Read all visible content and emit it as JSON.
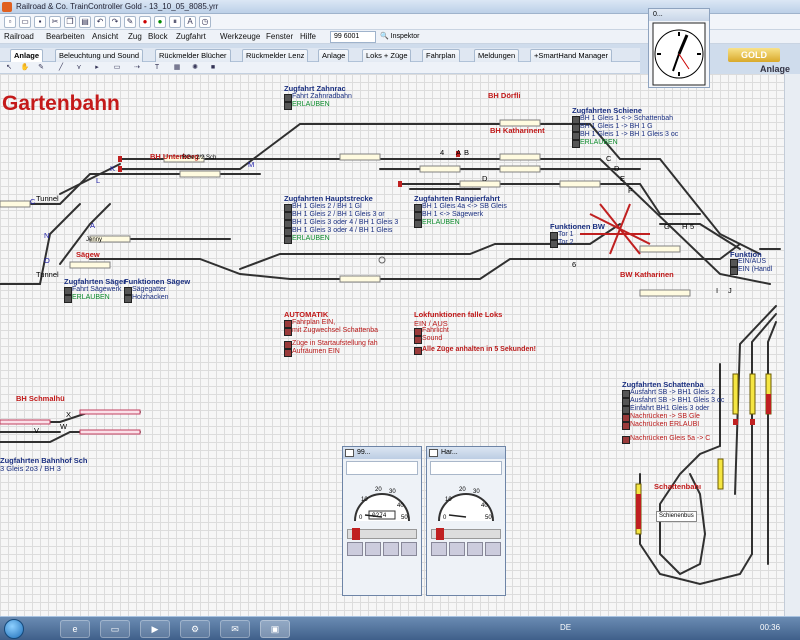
{
  "window": {
    "title": "Railroad & Co. TrainController Gold - 13_10_05_8085.yrr"
  },
  "menu": {
    "items": [
      "Railroad",
      "Bearbeiten",
      "Ansicht",
      "Zug",
      "Block",
      "Zugfahrt",
      "Werkzeuge",
      "Fenster",
      "Hilfe"
    ],
    "loco_select": "99 6001",
    "inspector": "Inspektor"
  },
  "tabs": [
    "Anlage",
    "Beleuchtung und Sound",
    "Rückmelder Blücher",
    "Rückmelder Lenz",
    "Anlage",
    "Loks + Züge",
    "Fahrplan",
    "Meldungen",
    "+SmartHand Manager"
  ],
  "badge": {
    "gold": "GOLD",
    "right_label": "Anlage"
  },
  "clock": {
    "title": "0..."
  },
  "layout": {
    "title": "Gartenbahn",
    "station_labels": {
      "bh_unterberg": "BH Unterberg",
      "bh_doerfli": "BH Dörfli",
      "bh_katharinent": "BH Katharinent",
      "saegew": "Sägew",
      "bh_schmalh": "BH Schmalhü",
      "bw_katharinen": "BW Katharinen",
      "schattenbahn": "Schattenbahı",
      "tunnel1": "Tunnel",
      "tunnel2": "Tunnel",
      "jenny": "Jenny",
      "rge": "RGe 2/2 Sch",
      "schienenbus": "Schienenbus"
    },
    "track_letters": {
      "a1": "A",
      "b1": "B",
      "c1": "C",
      "k": "K",
      "l": "L",
      "m": "M",
      "n": "N",
      "o": "O",
      "n4": "4",
      "a2": "A",
      "b2": "B",
      "d1": "D",
      "e1": "E",
      "c2": "C",
      "d2": "D",
      "e2": "E",
      "f": "F",
      "g": "G",
      "h": "H",
      "five": "5",
      "six": "6",
      "i": "I",
      "j": "J",
      "v": "V",
      "w": "W",
      "x": "X"
    },
    "blocks": {
      "zahnrad": {
        "title": "Zugfahrt Zahnrac",
        "lines": [
          "Fahrt Zahnradbahn"
        ],
        "green": "ERLAUBEN"
      },
      "schiene": {
        "title": "Zugfahrten Schiene",
        "lines": [
          "BH 1 Gleis 1 <-> Schattenbah",
          "BH 1 Gleis 1 -> BH 1 G",
          "BH 1 Gleis 1 -> BH 1 Gleis 3 oc"
        ],
        "green": "ERLAUBEN"
      },
      "haupt": {
        "title": "Zugfahrten Hauptstrecke",
        "lines": [
          "BH 1 Gleis 2 / BH 1 Gl",
          "BH 1 Gleis 2 / BH 1 Gleis 3 or",
          "BH 1 Gleis 3 oder 4 / BH 1 Gleis 3",
          "BH 1 Gleis 3 oder 4 / BH 1 Gleis"
        ],
        "green": "ERLAUBEN"
      },
      "rangier": {
        "title": "Zugfahrten Rangierfahrt",
        "lines": [
          "BH 1 Gleis 4a <-> SB Gleis",
          "BH 1 <-> Sägewerk"
        ],
        "green": "ERLAUBEN"
      },
      "funkbw": {
        "title": "Funktionen BW",
        "lines": [
          "Tor 1",
          "Tor 2"
        ]
      },
      "funktion": {
        "title": "Funktion",
        "lines": [
          "EIN/AUS",
          "EIN (Handl"
        ]
      },
      "saege1": {
        "title": "Zugfahrten Säger",
        "lines": [
          "Fahrt Sägewerk"
        ],
        "green": "ERLAUBEN"
      },
      "saege2": {
        "title": "Funktionen Sägew",
        "lines": [
          "Sägegatter",
          "Holzhacken"
        ]
      },
      "automatik": {
        "title": "AUTOMATIK",
        "lines": [
          "Fahrplan EIN,",
          "mit Zugwechsel Schattenba",
          "Züge in Startaufstellung fah",
          "Aufräumen EIN"
        ]
      },
      "lokfunk": {
        "title": "Lokfunktionen falle Loks",
        "lines": [
          "EIN / AUS",
          "Fahrlicht",
          "Sound"
        ],
        "red_bold": "Alle Züge anhalten in 5 Sekunden!"
      },
      "schatten": {
        "title": "Zugfahrten Schattenba",
        "lines": [
          "Ausfahrt SB -> BH1 Gleis 2",
          "Ausfahrt SB -> BH1 Gleis 3 oc",
          "Einfahrt BH1 Gleis 3 oder",
          "Nachrücken -> SB Gle",
          "Nachrücken ERLAUBI",
          "Nachrücken Gleis 5a -> C"
        ]
      },
      "bahnhof": {
        "title": "Zugfahrten Bahnhof Sch",
        "lines": [
          "3 Gleis 2o3 / BH 3"
        ]
      }
    }
  },
  "throttles": [
    {
      "title": "99...",
      "speed_readout": "0274",
      "gauge_ticks": [
        "0",
        "10",
        "20",
        "30",
        "40",
        "50"
      ]
    },
    {
      "title": "Har...",
      "speed_readout": "",
      "gauge_ticks": [
        "0",
        "10",
        "20",
        "30",
        "40",
        "50"
      ]
    }
  ],
  "taskbar": {
    "lang": "DE",
    "time": "00:36"
  }
}
